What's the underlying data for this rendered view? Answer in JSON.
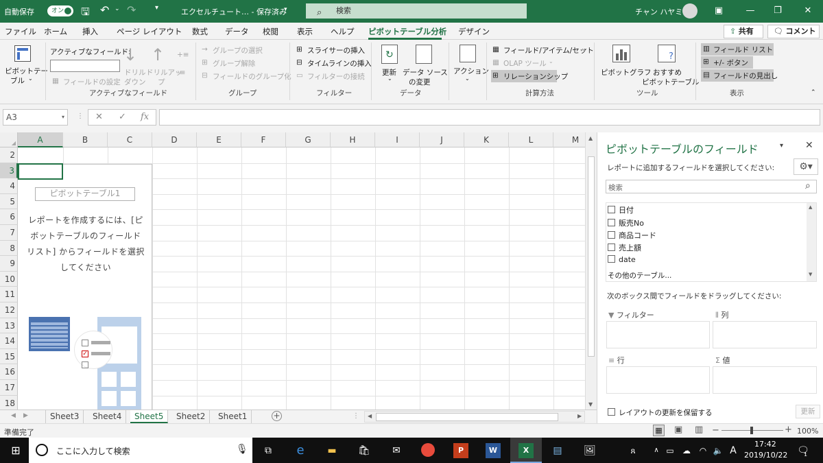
{
  "titlebar": {
    "autosave_label": "自動保存",
    "autosave_state": "オン",
    "doc_title": "エクセルチュート…  -  保存済み",
    "search_placeholder": "検索",
    "user_name": "チャン ハヤミ"
  },
  "tabs": [
    "ファイル",
    "ホーム",
    "挿入",
    "ページ レイアウト",
    "数式",
    "データ",
    "校閲",
    "表示",
    "ヘルプ",
    "ピボットテーブル分析",
    "デザイン"
  ],
  "active_tab": "ピボットテーブル分析",
  "share_label": "共有",
  "comment_label": "コメント",
  "ribbon": {
    "pivottable": {
      "label_line1": "ピボットテー",
      "label_line2": "ブル"
    },
    "active_field": {
      "label": "アクティブなフィールド:",
      "field_settings": "フィールドの設定",
      "drilldown_1": "ドリル",
      "drilldown_2": "ダウン",
      "drillup_1": "ドリルアッ",
      "drillup_2": "プ",
      "group_label": "アクティブなフィールド"
    },
    "group": {
      "selection": "グループの選択",
      "ungroup": "グループ解除",
      "field_group": "フィールドのグループ化",
      "group_label": "グループ"
    },
    "filter": {
      "slicer": "スライサーの挿入",
      "timeline": "タイムラインの挿入",
      "connections": "フィルターの接続",
      "group_label": "フィルター"
    },
    "data": {
      "refresh": "更新",
      "source_1": "データ ソース",
      "source_2": "の変更",
      "group_label": "データ"
    },
    "action": {
      "label": "アクション"
    },
    "calc": {
      "fields_items": "フィールド/アイテム/セット",
      "olap": "OLAP ツール",
      "relations": "リレーションシップ",
      "group_label": "計算方法"
    },
    "tools": {
      "pivotchart": "ピボットグラフ",
      "recommended_1": "おすすめ",
      "recommended_2": "ピボットテーブル",
      "group_label": "ツール"
    },
    "show": {
      "field_list": "フィールド リスト",
      "buttons": "+/- ボタン",
      "headers": "フィールドの見出し",
      "group_label": "表示"
    }
  },
  "formula_bar": {
    "name_box": "A3",
    "fx": "fx",
    "formula": ""
  },
  "columns": [
    "A",
    "B",
    "C",
    "D",
    "E",
    "F",
    "G",
    "H",
    "I",
    "J",
    "K",
    "L",
    "M"
  ],
  "rows": [
    "2",
    "3",
    "4",
    "5",
    "6",
    "7",
    "8",
    "9",
    "10",
    "11",
    "12",
    "13",
    "14",
    "15",
    "16",
    "17",
    "18"
  ],
  "pivot_placeholder": {
    "name": "ピボットテーブル1",
    "line1": "レポートを作成するには、[ピ",
    "line2": "ボットテーブルのフィールド",
    "line3": "リスト] からフィールドを選択",
    "line4": "してください"
  },
  "sheets": [
    "Sheet3",
    "Sheet4",
    "Sheet5",
    "Sheet2",
    "Sheet1"
  ],
  "active_sheet": "Sheet5",
  "status": {
    "ready": "準備完了",
    "zoom": "100%"
  },
  "panel": {
    "title": "ピボットテーブルのフィールド",
    "subtitle": "レポートに追加するフィールドを選択してください:",
    "search_placeholder": "検索",
    "fields": [
      "日付",
      "販売No",
      "商品コード",
      "売上額",
      "date"
    ],
    "more_tables": "その他のテーブル...",
    "drag_label": "次のボックス間でフィールドをドラッグしてください:",
    "area_filter": "フィルター",
    "area_columns": "列",
    "area_rows": "行",
    "area_values": "値",
    "defer_label": "レイアウトの更新を保留する",
    "update_button": "更新"
  },
  "taskbar": {
    "search_placeholder": "ここに入力して検索",
    "time": "17:42",
    "date": "2019/10/22",
    "ime": "A",
    "notif_count": "1"
  },
  "colors": {
    "excel_green": "#217346",
    "taskbar": "#101010"
  }
}
